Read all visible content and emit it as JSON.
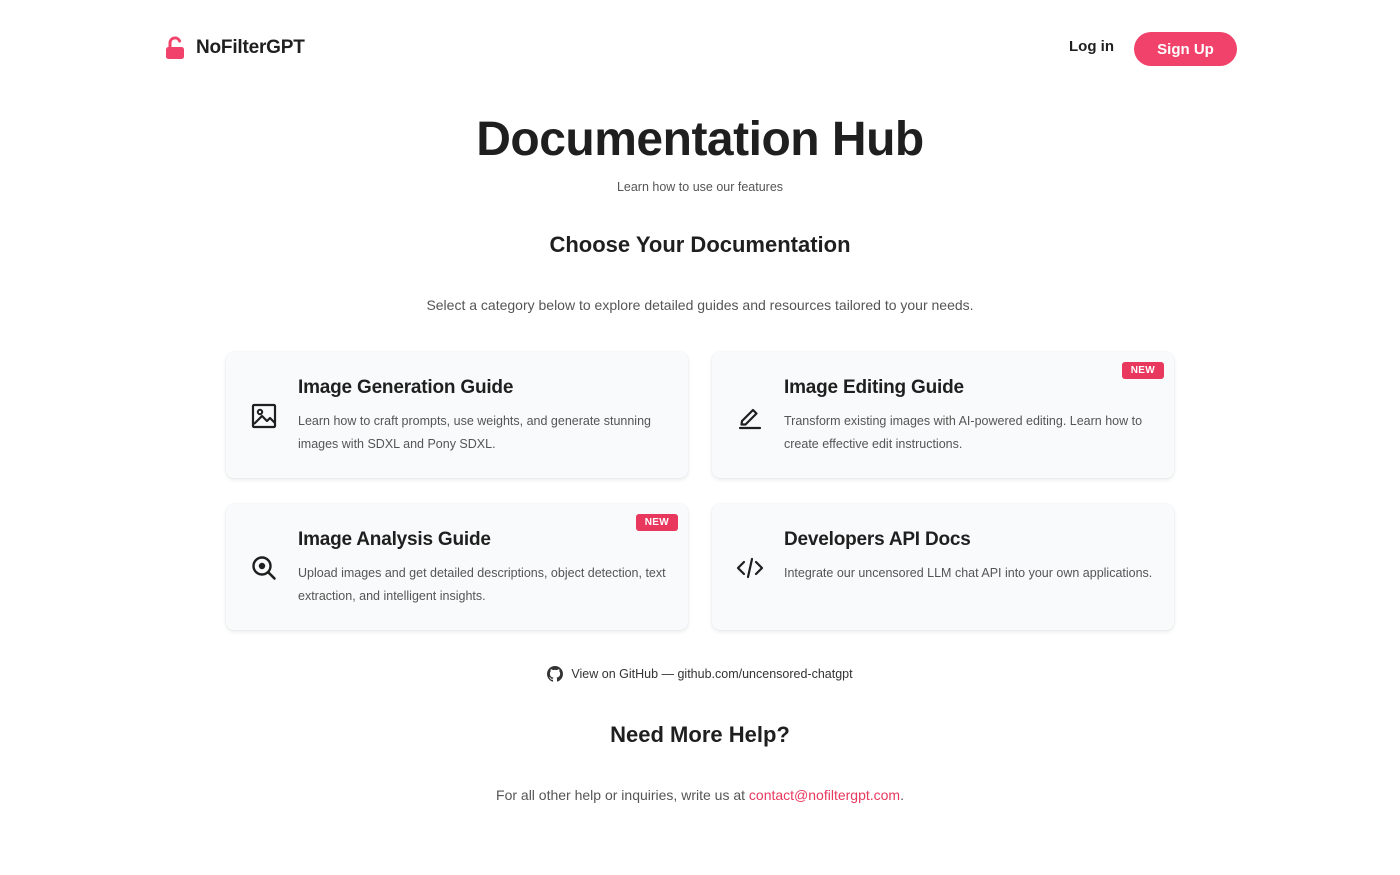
{
  "header": {
    "brand_name": "NoFilterGPT",
    "brand_icon": "unlocked-padlock-icon",
    "login_label": "Log in",
    "signup_label": "Sign Up"
  },
  "hero": {
    "title": "Documentation Hub",
    "subtitle": "Learn how to use our features"
  },
  "section": {
    "title": "Choose Your Documentation",
    "description": "Select a category below to explore detailed guides and resources tailored to your needs."
  },
  "cards": [
    {
      "title": "Image Generation Guide",
      "description": "Learn how to craft prompts, use weights, and generate stunning images with SDXL and Pony SDXL.",
      "icon": "image-icon",
      "badge": ""
    },
    {
      "title": "Image Editing Guide",
      "description": "Transform existing images with AI-powered editing. Learn how to create effective edit instructions.",
      "icon": "pencil-icon",
      "badge": "NEW"
    },
    {
      "title": "Image Analysis Guide",
      "description": "Upload images and get detailed descriptions, object detection, text extraction, and intelligent insights.",
      "icon": "magnifier-icon",
      "badge": "NEW"
    },
    {
      "title": "Developers API Docs",
      "description": "Integrate our uncensored LLM chat API into your own applications.",
      "icon": "code-icon",
      "badge": ""
    }
  ],
  "github": {
    "icon": "github-icon",
    "text": "View on GitHub — github.com/uncensored-chatgpt"
  },
  "help": {
    "title": "Need More Help?",
    "text_prefix": "For all other help or inquiries, write us at ",
    "email": "contact@nofiltergpt.com",
    "text_suffix": "."
  },
  "colors": {
    "accent": "#f0426a",
    "badge": "#e8385e",
    "text": "#1f1f1f",
    "muted": "#555555",
    "card_bg": "#f9fafb"
  }
}
